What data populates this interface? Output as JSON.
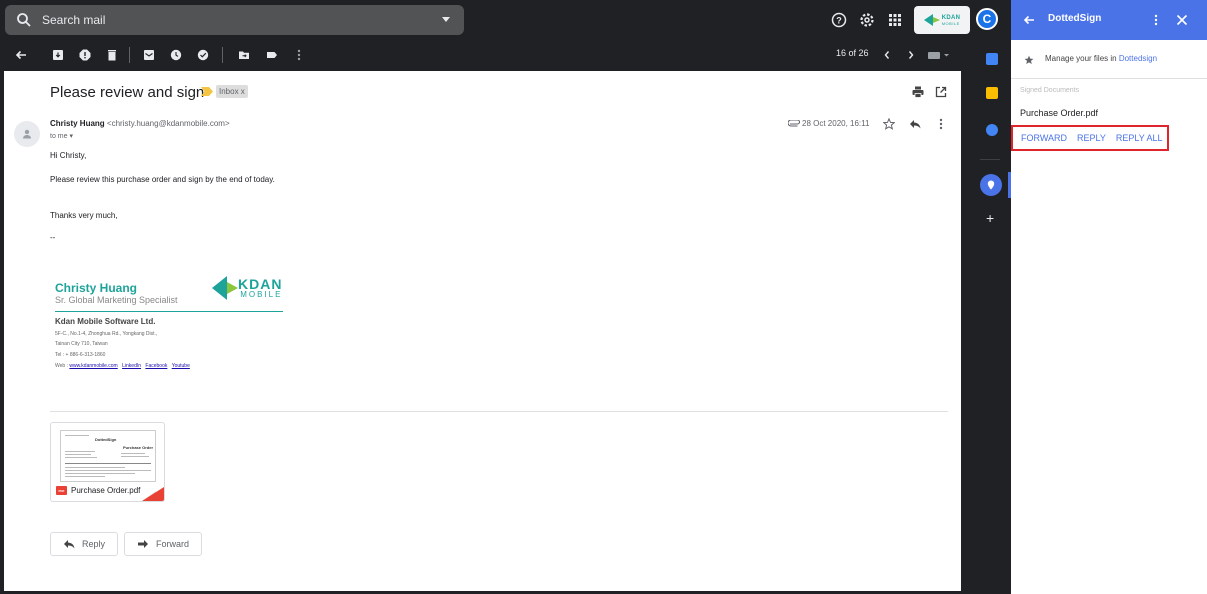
{
  "search": {
    "placeholder": "Search mail"
  },
  "header": {
    "kdan_logo": "KDAN",
    "kdan_logo_sub": "MOBILE",
    "account_initial": "C"
  },
  "toolbar": {
    "counter": "16 of 26"
  },
  "email": {
    "subject": "Please review and sign",
    "label": "Inbox x",
    "sender_name": "Christy Huang",
    "sender_email": "<christy.huang@kdanmobile.com>",
    "to": "to me",
    "date": "28 Oct 2020, 16:11",
    "greeting": "Hi Christy,",
    "line1": "Please review this purchase order and sign by the end of today.",
    "thanks": "Thanks very much,",
    "dash": "--"
  },
  "signature": {
    "name": "Christy Huang",
    "title": "Sr. Global Marketing Specialist",
    "logo_main": "KDAN",
    "logo_sub": "MOBILE",
    "company": "Kdan Mobile Software Ltd.",
    "address1": "5F-C., No.1-4, Zhonghua Rd., Yongkang Dist.,",
    "address2": "Tainan City 710, Taiwan",
    "tel": "Tel : + 886-6-313-1860",
    "web_label": "Web :",
    "web_link": "www.kdanmobile.com",
    "linkedin": "LinkedIn",
    "facebook": "Facebook",
    "youtube": "Youtube"
  },
  "attachment": {
    "filename": "Purchase Order.pdf",
    "badge": "PDF",
    "thumb_brand": "DottedSign",
    "thumb_title": "Purchase Order"
  },
  "buttons": {
    "reply": "Reply",
    "forward": "Forward"
  },
  "panel": {
    "title": "DottedSign",
    "manage_text": "Manage your files in",
    "manage_link": "Dottedsign",
    "section": "Signed Documents",
    "file": "Purchase Order.pdf",
    "forward": "FORWARD",
    "reply": "REPLY",
    "reply_all": "REPLY ALL",
    "header_color": "#4a73e8"
  }
}
